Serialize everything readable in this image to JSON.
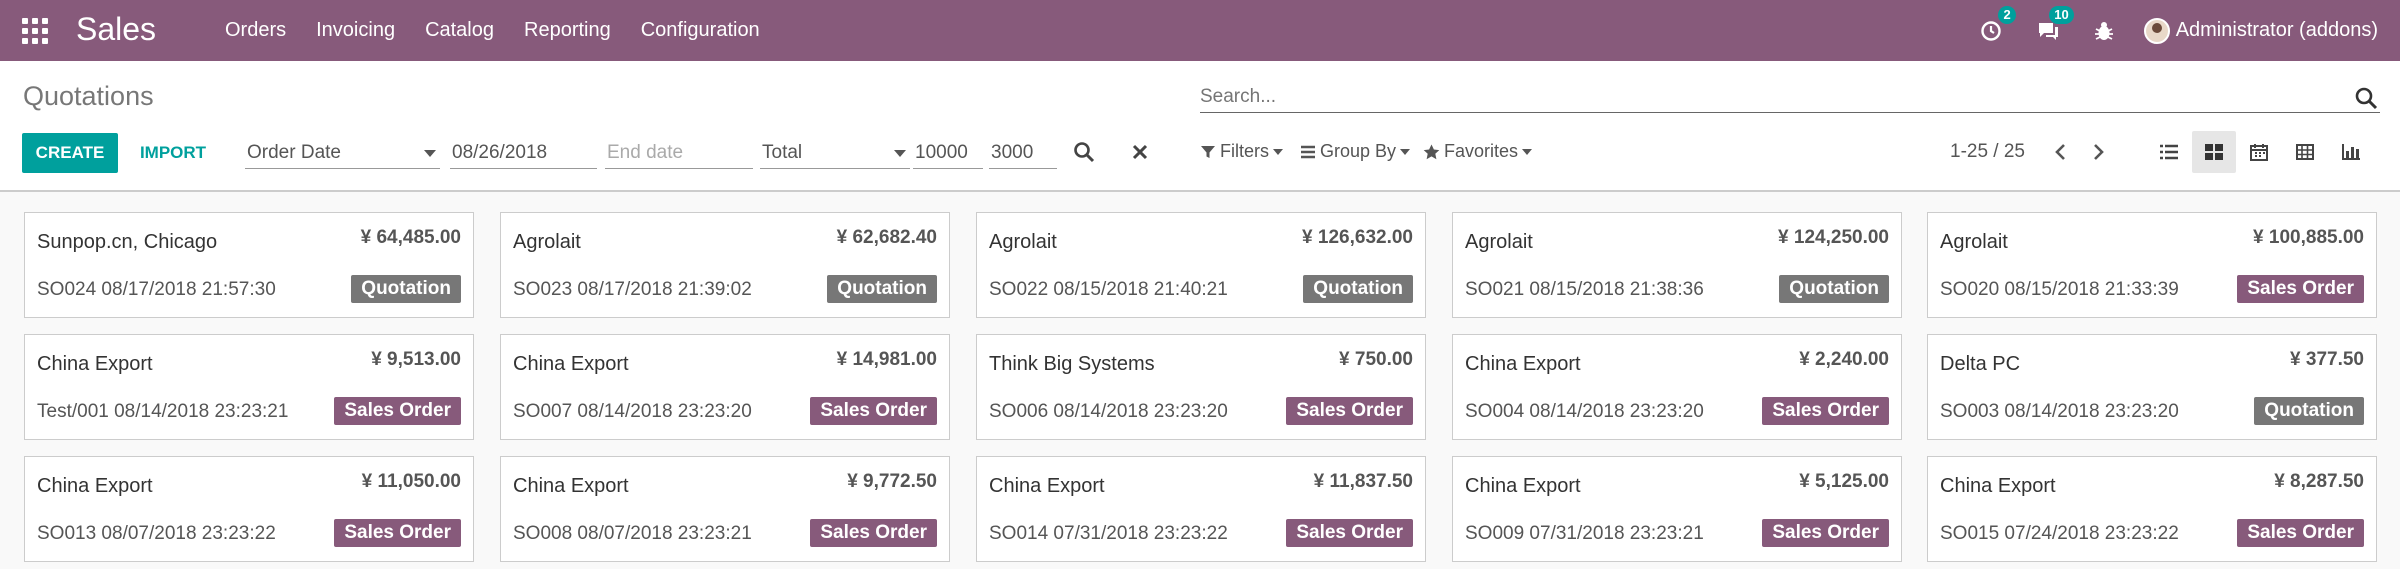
{
  "app": {
    "name": "Sales"
  },
  "menu": [
    "Orders",
    "Invoicing",
    "Catalog",
    "Reporting",
    "Configuration"
  ],
  "systray": {
    "activity_count": "2",
    "messages_count": "10",
    "user": "Administrator (addons)"
  },
  "page": {
    "title": "Quotations"
  },
  "search": {
    "placeholder": "Search..."
  },
  "buttons": {
    "create": "CREATE",
    "import": "IMPORT"
  },
  "filters_row": {
    "date_field": "Order Date",
    "start_date": "08/26/2018",
    "end_date_placeholder": "End date",
    "amount_field": "Total",
    "amount_min": "10000",
    "amount_max": "3000"
  },
  "search_options": {
    "filters": "Filters",
    "group_by": "Group By",
    "favorites": "Favorites"
  },
  "pager": {
    "text": "1-25 / 25"
  },
  "views": [
    "list",
    "kanban",
    "calendar",
    "pivot",
    "graph"
  ],
  "colors": {
    "brand": "#875a7b",
    "accent": "#00a09d",
    "quotation": "#777777"
  },
  "cards": [
    {
      "partner": "Sunpop.cn, Chicago",
      "amount": "¥ 64,485.00",
      "ref": "SO024 08/17/2018 21:57:30",
      "status": "Quotation"
    },
    {
      "partner": "Agrolait",
      "amount": "¥ 62,682.40",
      "ref": "SO023 08/17/2018 21:39:02",
      "status": "Quotation"
    },
    {
      "partner": "Agrolait",
      "amount": "¥ 126,632.00",
      "ref": "SO022 08/15/2018 21:40:21",
      "status": "Quotation"
    },
    {
      "partner": "Agrolait",
      "amount": "¥ 124,250.00",
      "ref": "SO021 08/15/2018 21:38:36",
      "status": "Quotation"
    },
    {
      "partner": "Agrolait",
      "amount": "¥ 100,885.00",
      "ref": "SO020 08/15/2018 21:33:39",
      "status": "Sales Order"
    },
    {
      "partner": "China Export",
      "amount": "¥ 9,513.00",
      "ref": "Test/001 08/14/2018 23:23:21",
      "status": "Sales Order"
    },
    {
      "partner": "China Export",
      "amount": "¥ 14,981.00",
      "ref": "SO007 08/14/2018 23:23:20",
      "status": "Sales Order"
    },
    {
      "partner": "Think Big Systems",
      "amount": "¥ 750.00",
      "ref": "SO006 08/14/2018 23:23:20",
      "status": "Sales Order"
    },
    {
      "partner": "China Export",
      "amount": "¥ 2,240.00",
      "ref": "SO004 08/14/2018 23:23:20",
      "status": "Sales Order"
    },
    {
      "partner": "Delta PC",
      "amount": "¥ 377.50",
      "ref": "SO003 08/14/2018 23:23:20",
      "status": "Quotation"
    },
    {
      "partner": "China Export",
      "amount": "¥ 11,050.00",
      "ref": "SO013 08/07/2018 23:23:22",
      "status": "Sales Order"
    },
    {
      "partner": "China Export",
      "amount": "¥ 9,772.50",
      "ref": "SO008 08/07/2018 23:23:21",
      "status": "Sales Order"
    },
    {
      "partner": "China Export",
      "amount": "¥ 11,837.50",
      "ref": "SO014 07/31/2018 23:23:22",
      "status": "Sales Order"
    },
    {
      "partner": "China Export",
      "amount": "¥ 5,125.00",
      "ref": "SO009 07/31/2018 23:23:21",
      "status": "Sales Order"
    },
    {
      "partner": "China Export",
      "amount": "¥ 8,287.50",
      "ref": "SO015 07/24/2018 23:23:22",
      "status": "Sales Order"
    }
  ]
}
